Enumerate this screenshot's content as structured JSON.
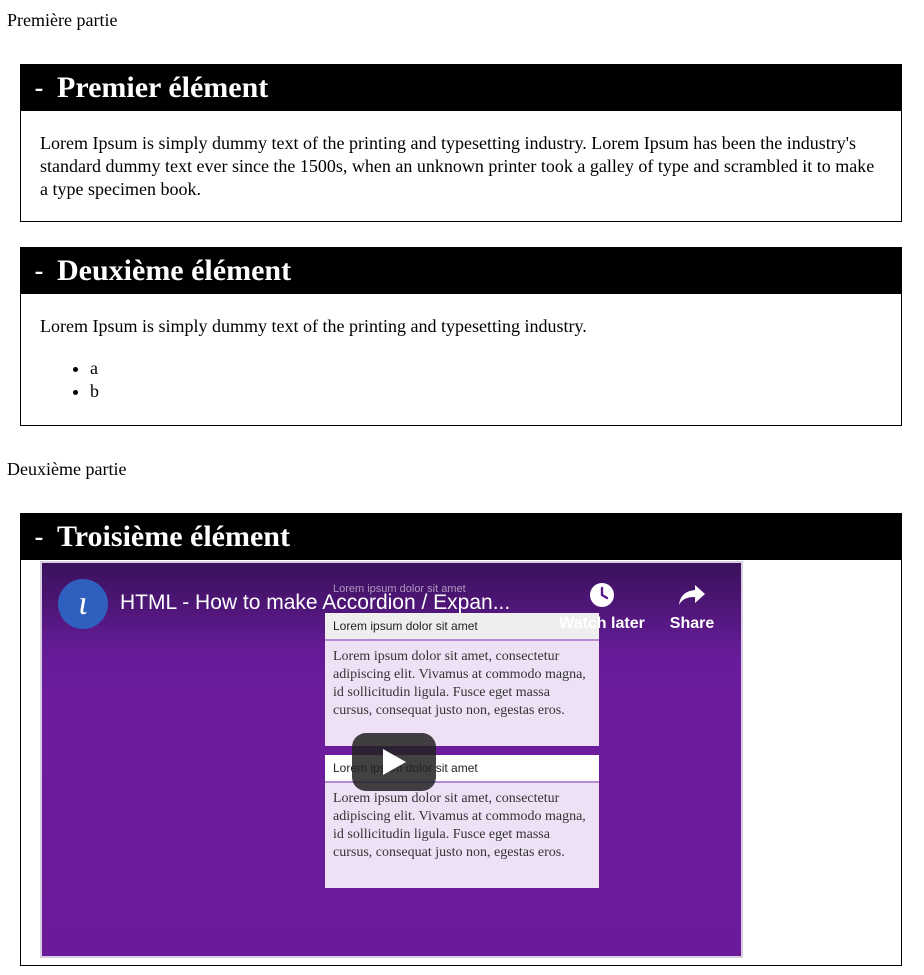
{
  "parts": [
    {
      "label": "Première partie"
    },
    {
      "label": "Deuxième partie"
    }
  ],
  "accordions": [
    {
      "toggle": "-",
      "title": "Premier élément",
      "body": "Lorem Ipsum is simply dummy text of the printing and typesetting industry. Lorem Ipsum has been the industry's standard dummy text ever since the 1500s, when an unknown printer took a galley of type and scrambled it to make a type specimen book."
    },
    {
      "toggle": "-",
      "title": "Deuxième élément",
      "body": "Lorem Ipsum is simply dummy text of the printing and typesetting industry.",
      "list": [
        "a",
        "b"
      ]
    },
    {
      "toggle": "-",
      "title": "Troisième élément"
    }
  ],
  "video": {
    "title": "HTML - How to make Accordion / Expan...",
    "watch_later": "Watch later",
    "share": "Share",
    "logo_icon": "channel-logo-icon",
    "frame": {
      "ghost_heading": "Lorem ipsum dolor sit amet",
      "heading_1": "Lorem ipsum dolor sit amet",
      "text_1": "Lorem ipsum dolor sit amet, consectetur adipiscing elit. Vivamus at commodo magna, id sollicitudin ligula. Fusce eget massa cursus, consequat justo non, egestas eros.",
      "heading_2": "Lorem ipsum dolor sit amet",
      "text_2": "Lorem ipsum dolor sit amet, consectetur adipiscing elit. Vivamus at commodo magna, id sollicitudin ligula. Fusce eget massa cursus, consequat justo non, egestas eros."
    }
  }
}
